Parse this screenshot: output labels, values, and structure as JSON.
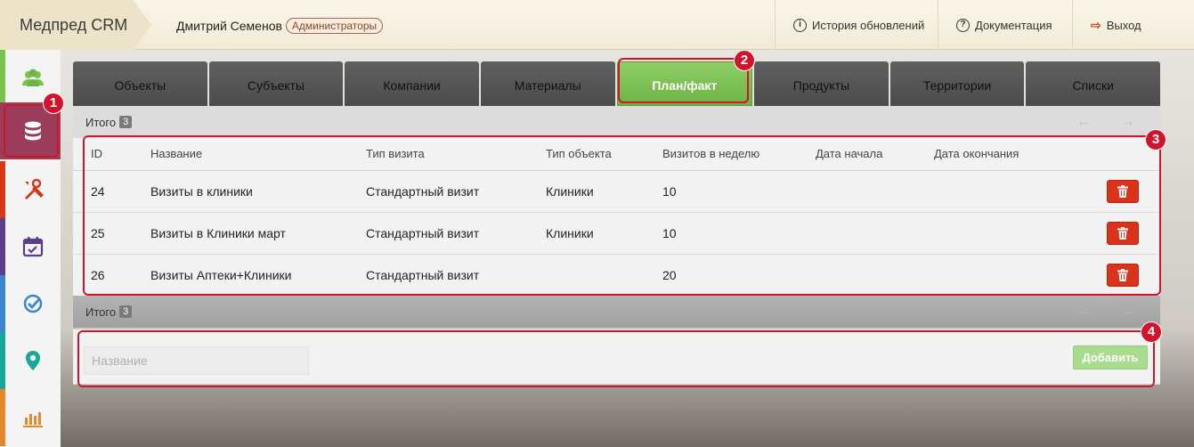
{
  "app": {
    "title": "Медпред CRM"
  },
  "user": {
    "name": "Дмитрий Семенов",
    "role": "Администраторы"
  },
  "topnav": {
    "history": "История обновлений",
    "docs": "Документация",
    "logout": "Выход"
  },
  "sidebar": {
    "items": [
      {
        "icon": "users-icon",
        "color": "#7cc24f"
      },
      {
        "icon": "database-icon",
        "color": "#9b3d5b",
        "active": true
      },
      {
        "icon": "tools-icon",
        "color": "#d3381b"
      },
      {
        "icon": "calendar-check-icon",
        "color": "#5b3e86"
      },
      {
        "icon": "checkmark-circle-icon",
        "color": "#3a86c8"
      },
      {
        "icon": "map-pin-icon",
        "color": "#1aa69b"
      },
      {
        "icon": "bar-chart-icon",
        "color": "#e08a2b"
      }
    ]
  },
  "tabs": [
    "Объекты",
    "Субъекты",
    "Компании",
    "Материалы",
    "План/факт",
    "Продукты",
    "Территории",
    "Списки"
  ],
  "active_tab": "План/факт",
  "totals": {
    "label": "Итого",
    "count": "3"
  },
  "table": {
    "headers": [
      "ID",
      "Название",
      "Тип визита",
      "Тип объекта",
      "Визитов в неделю",
      "Дата начала",
      "Дата окончания"
    ],
    "rows": [
      {
        "id": "24",
        "name": "Визиты в клиники",
        "visit_type": "Стандартный визит",
        "object_type": "Клиники",
        "per_week": "10",
        "start": "",
        "end": ""
      },
      {
        "id": "25",
        "name": "Визиты в Клиники март",
        "visit_type": "Стандартный визит",
        "object_type": "Клиники",
        "per_week": "10",
        "start": "",
        "end": ""
      },
      {
        "id": "26",
        "name": "Визиты Аптеки+Клиники",
        "visit_type": "Стандартный визит",
        "object_type": "",
        "per_week": "20",
        "start": "",
        "end": ""
      }
    ]
  },
  "add_form": {
    "placeholder": "Название",
    "button": "Добавить"
  },
  "annotations": [
    "1",
    "2",
    "3",
    "4"
  ],
  "colors": {
    "accent_red": "#d1132b",
    "active_tab": "#7cc24f",
    "delete": "#d9331b"
  }
}
